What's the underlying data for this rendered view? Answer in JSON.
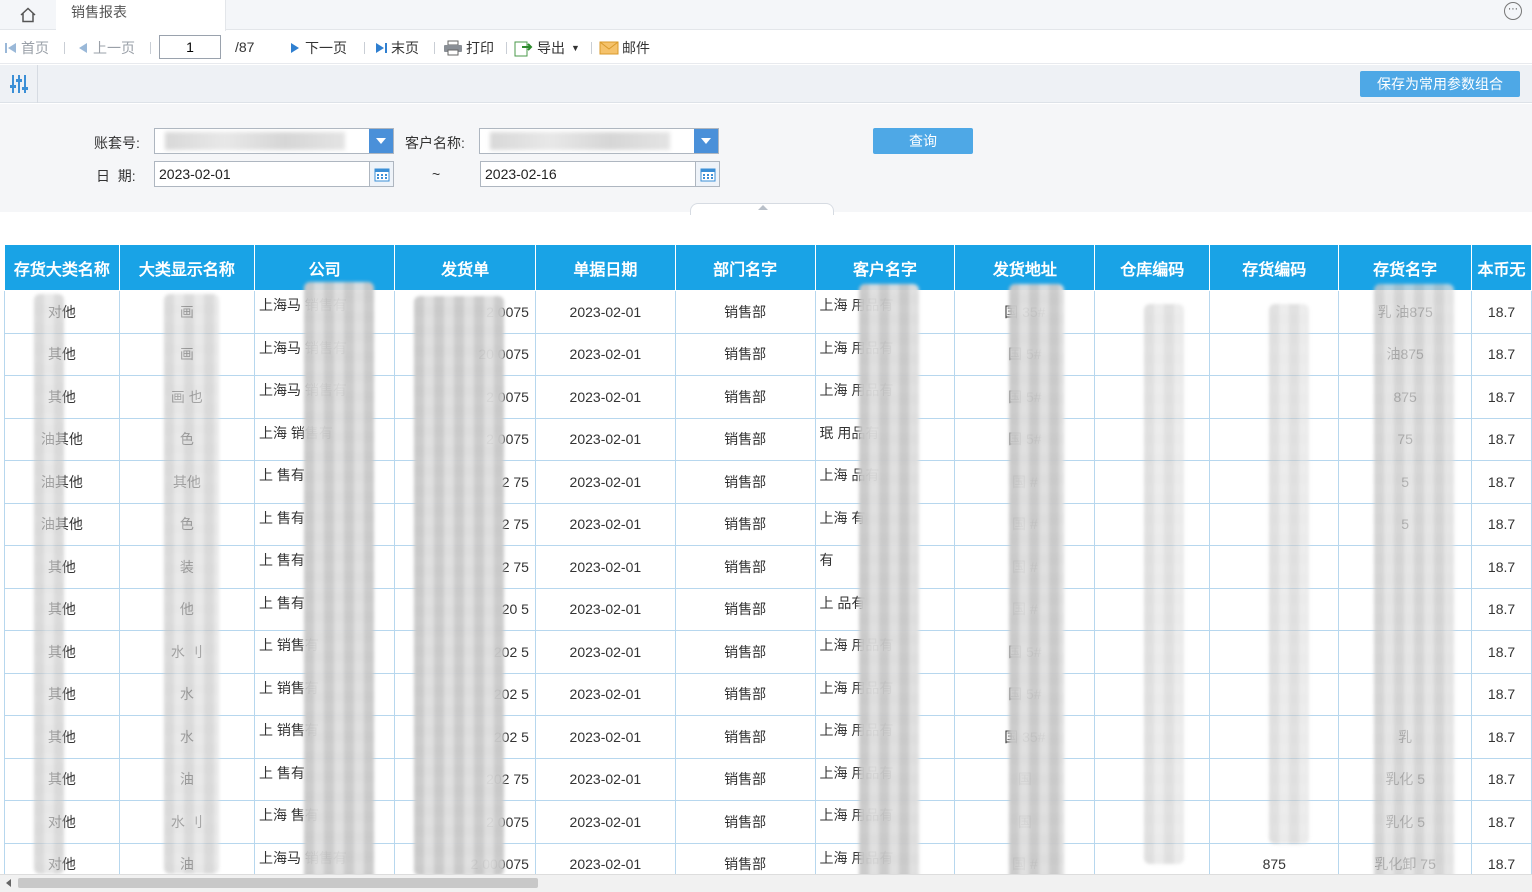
{
  "tabs": {
    "active": "销售报表"
  },
  "toolbar": {
    "first": "首页",
    "prev": "上一页",
    "page": "1",
    "total": "/87",
    "next": "下一页",
    "last": "末页",
    "print": "打印",
    "export": "导出",
    "mail": "邮件"
  },
  "filterbar": {
    "save_label": "保存为常用参数组合"
  },
  "form": {
    "account_label": "账套号:",
    "customer_label": "客户名称:",
    "date_label": "日  期:",
    "date_from": "2023-02-01",
    "date_sep": "~",
    "date_to": "2023-02-16",
    "query_label": "查询"
  },
  "colors": {
    "header": "#19a3e6",
    "button": "#4ea8e6",
    "combo_arrow": "#4a90d9"
  },
  "table": {
    "columns": [
      "存货大类名称",
      "大类显示名称",
      "公司",
      "发货单",
      "单据日期",
      "部门名字",
      "客户名字",
      "发货地址",
      "仓库编码",
      "存货编码",
      "存货名字",
      "本币无"
    ],
    "rows": [
      [
        "对他",
        "画",
        "上海马 销售有",
        "2 0075",
        "2023-02-01",
        "销售部",
        "上海 用品有",
        "国 35#",
        "",
        "",
        "乳 油875",
        "18.7"
      ],
      [
        "其他",
        "画",
        "上海马 销售有",
        "20 0075",
        "2023-02-01",
        "销售部",
        "上海 用品有",
        "国 5#",
        "",
        "",
        "油875",
        "18.7"
      ],
      [
        "其他",
        "画 也",
        "上海马 销售有",
        "2 0075",
        "2023-02-01",
        "销售部",
        "上海 用品有",
        "国 5#",
        "",
        "",
        "875",
        "18.7"
      ],
      [
        "油其他",
        "色",
        "上海 销售有",
        "2 0075",
        "2023-02-01",
        "销售部",
        "珉 用品有",
        "国 5#",
        "",
        "",
        "75",
        "18.7"
      ],
      [
        "油其他",
        "其他",
        "上 售有",
        "2 75",
        "2023-02-01",
        "销售部",
        "上海 品有",
        "国 #",
        "",
        "",
        "5",
        "18.7"
      ],
      [
        "油其他",
        "色",
        "上 售有",
        "2 75",
        "2023-02-01",
        "销售部",
        "上海 有",
        "国 #",
        "",
        "",
        "5",
        "18.7"
      ],
      [
        "其他",
        "装",
        "上 售有",
        "2 75",
        "2023-02-01",
        "销售部",
        "有",
        "国 #",
        "",
        "",
        "",
        "18.7"
      ],
      [
        "其他",
        "他",
        "上 售有",
        "20 5",
        "2023-02-01",
        "销售部",
        "上 品有",
        "国 #",
        "",
        "",
        "",
        "18.7"
      ],
      [
        "其他",
        "水 刂",
        "上 销售有",
        "202 5",
        "2023-02-01",
        "销售部",
        "上海 用品有",
        "国 5#",
        "",
        "",
        "",
        "18.7"
      ],
      [
        "其他",
        "水",
        "上 销售有",
        "202 5",
        "2023-02-01",
        "销售部",
        "上海 用品有",
        "国 5#",
        "",
        "",
        "",
        "18.7"
      ],
      [
        "其他",
        "水",
        "上 销售有",
        "202 5",
        "2023-02-01",
        "销售部",
        "上海 用品有",
        "国 35#",
        "",
        "",
        "乳",
        "18.7"
      ],
      [
        "其他",
        "油",
        "上 售有",
        "202 75",
        "2023-02-01",
        "销售部",
        "上海 用品有",
        "国",
        "",
        "",
        "乳化 5",
        "18.7"
      ],
      [
        "对他",
        "水 刂",
        "上海 售有",
        "2 0075",
        "2023-02-01",
        "销售部",
        "上海 用品有",
        "国",
        "",
        "",
        "乳化 5",
        "18.7"
      ],
      [
        "对他",
        "油",
        "上海马 销售有",
        "2 000075",
        "2023-02-01",
        "销售部",
        "上海 用品有",
        "国 #",
        "",
        "875",
        "乳化卸 75",
        "18.7"
      ]
    ]
  }
}
